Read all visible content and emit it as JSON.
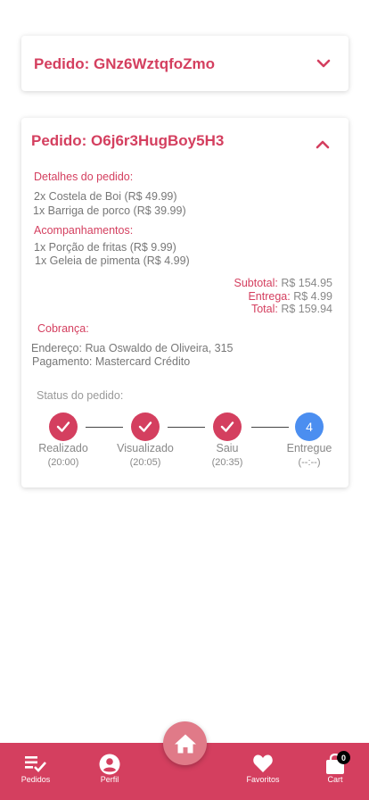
{
  "colors": {
    "accent": "#d43f5f",
    "pending_step": "#4b8ef0",
    "nav_bg": "#d43f5f",
    "home_button": "#e07a88"
  },
  "orders": [
    {
      "title": "Pedido: GNz6WztqfoZmo",
      "expanded": false
    },
    {
      "title": "Pedido: O6j6r3HugBoy5H3",
      "expanded": true,
      "details_label": "Detalhes do pedido:",
      "items": [
        "2x Costela de Boi (R$ 49.99)",
        "1x Barriga de porco (R$ 39.99)"
      ],
      "sides_label": "Acompanhamentos:",
      "sides": [
        "1x Porção de fritas (R$ 9.99)",
        "1x Geleia de pimenta (R$ 4.99)"
      ],
      "subtotal_label": "Subtotal:",
      "subtotal_value": "R$ 154.95",
      "delivery_label": "Entrega:",
      "delivery_value": "R$ 4.99",
      "total_label": "Total:",
      "total_value": "R$ 159.94",
      "billing_label": "Cobrança:",
      "address": "Endereço: Rua Oswaldo de Oliveira, 315",
      "payment": "Pagamento: Mastercard Crédito",
      "status_label": "Status do pedido:",
      "steps": [
        {
          "name": "Realizado",
          "time": "(20:00)",
          "done": true
        },
        {
          "name": "Visualizado",
          "time": "(20:05)",
          "done": true
        },
        {
          "name": "Saiu",
          "time": "(20:35)",
          "done": true
        },
        {
          "name": "Entregue",
          "time": "(--:--)",
          "done": false,
          "number": "4"
        }
      ]
    }
  ],
  "nav": {
    "items": [
      {
        "label": "Pedidos",
        "icon": "order-list-icon"
      },
      {
        "label": "Perfil",
        "icon": "account-circle-icon"
      },
      {
        "label": "Favoritos",
        "icon": "heart-icon"
      },
      {
        "label": "Cart",
        "icon": "shopping-bag-icon"
      }
    ],
    "home_icon": "home-icon",
    "cart_count": "0"
  }
}
